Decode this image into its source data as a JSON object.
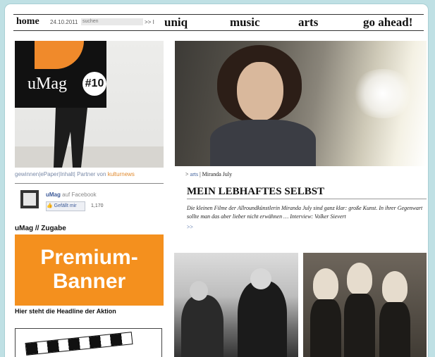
{
  "nav": {
    "home": "home",
    "date": "24.10.2011",
    "search_placeholder": "suchen",
    "search_go": ">> I",
    "items": [
      "uniq",
      "music",
      "arts",
      "go ahead!"
    ]
  },
  "cover": {
    "brand": "uMag",
    "issue": "#10",
    "links": {
      "gewinnen": "gewinnen",
      "epaper": "ePaper",
      "inhalt": "Inhalt",
      "partner": "Partner von",
      "kultur": "kulturnews"
    }
  },
  "facebook": {
    "name": "uMag",
    "suffix": "auf Facebook",
    "like_label": "Gefällt mir",
    "count": "1,170"
  },
  "promo": {
    "section": "uMag // Zugabe",
    "banner_line1": "Premium-",
    "banner_line2": "Banner",
    "headline": "Hier steht die Headline der Aktion"
  },
  "article": {
    "crumb_arrow": "> ",
    "crumb_section": "arts",
    "crumb_title": " | Miranda July",
    "headline": "MEIN LEBHAFTES SELBST",
    "teaser": "Die kleinen Filme der Allroundkünstlerin Miranda July sind ganz klar: große Kunst. In ihrer Gegenwart sollte man das aber lieber nicht erwähnen … Interview: Volker Sievert",
    "more": ">>"
  },
  "colors": {
    "background": "#bfe0e4",
    "accent_orange": "#f4901e",
    "link_blue": "#3a5d9a"
  }
}
